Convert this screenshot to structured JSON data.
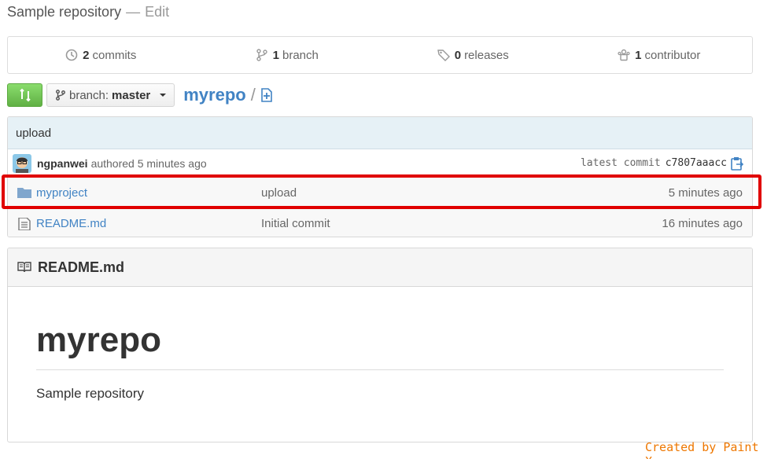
{
  "header": {
    "title": "Sample repository",
    "dash": "—",
    "edit": "Edit"
  },
  "stats": [
    {
      "count": "2",
      "label": "commits",
      "icon": "history-icon"
    },
    {
      "count": "1",
      "label": "branch",
      "icon": "branch-icon"
    },
    {
      "count": "0",
      "label": "releases",
      "icon": "tag-icon"
    },
    {
      "count": "1",
      "label": "contributor",
      "icon": "organization-icon"
    }
  ],
  "toolbar": {
    "branch_prefix": "branch:",
    "branch_name": "master",
    "repo": "myrepo",
    "separator": "/"
  },
  "commit": {
    "message": "upload",
    "author": "ngpanwei",
    "authored": "authored 5 minutes ago",
    "latest_label": "latest commit",
    "sha": "c7807aaacc"
  },
  "files": [
    {
      "name": "myproject",
      "type": "folder",
      "message": "upload",
      "age": "5 minutes ago"
    },
    {
      "name": "README.md",
      "type": "file",
      "message": "Initial commit",
      "age": "16 minutes ago"
    }
  ],
  "readme": {
    "filename": "README.md",
    "heading": "myrepo",
    "body": "Sample repository"
  },
  "watermark": "Created by Paint X",
  "colors": {
    "link": "#4183c4",
    "highlight": "#e00000",
    "compare_button": "#60b044",
    "watermark": "#ee7700"
  }
}
